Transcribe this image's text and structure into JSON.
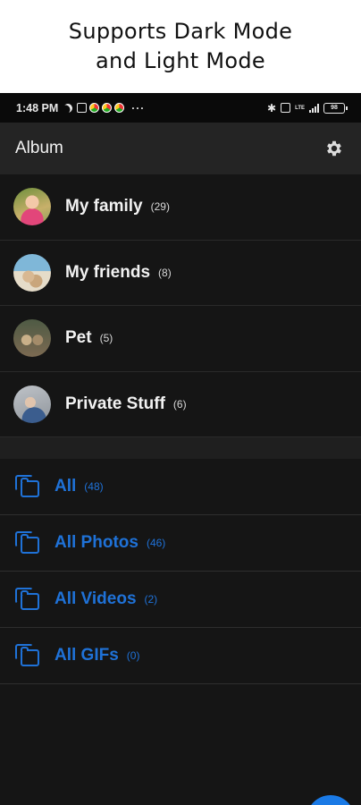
{
  "promo": {
    "line1": "Supports Dark Mode",
    "line2": "and Light Mode"
  },
  "status_bar": {
    "time": "1:48 PM",
    "more": "···",
    "network": "LTE",
    "battery": "98"
  },
  "header": {
    "title": "Album",
    "settings_icon": "gear-icon"
  },
  "albums": [
    {
      "name": "My family",
      "count": "(29)"
    },
    {
      "name": "My friends",
      "count": "(8)"
    },
    {
      "name": "Pet",
      "count": "(5)"
    },
    {
      "name": "Private Stuff",
      "count": "(6)"
    }
  ],
  "filters": [
    {
      "name": "All",
      "count": "(48)"
    },
    {
      "name": "All Photos",
      "count": "(46)"
    },
    {
      "name": "All Videos",
      "count": "(2)"
    },
    {
      "name": "All GIFs",
      "count": "(0)"
    }
  ],
  "colors": {
    "accent": "#1f72d8",
    "background": "#151515",
    "app_bar": "#242424"
  }
}
